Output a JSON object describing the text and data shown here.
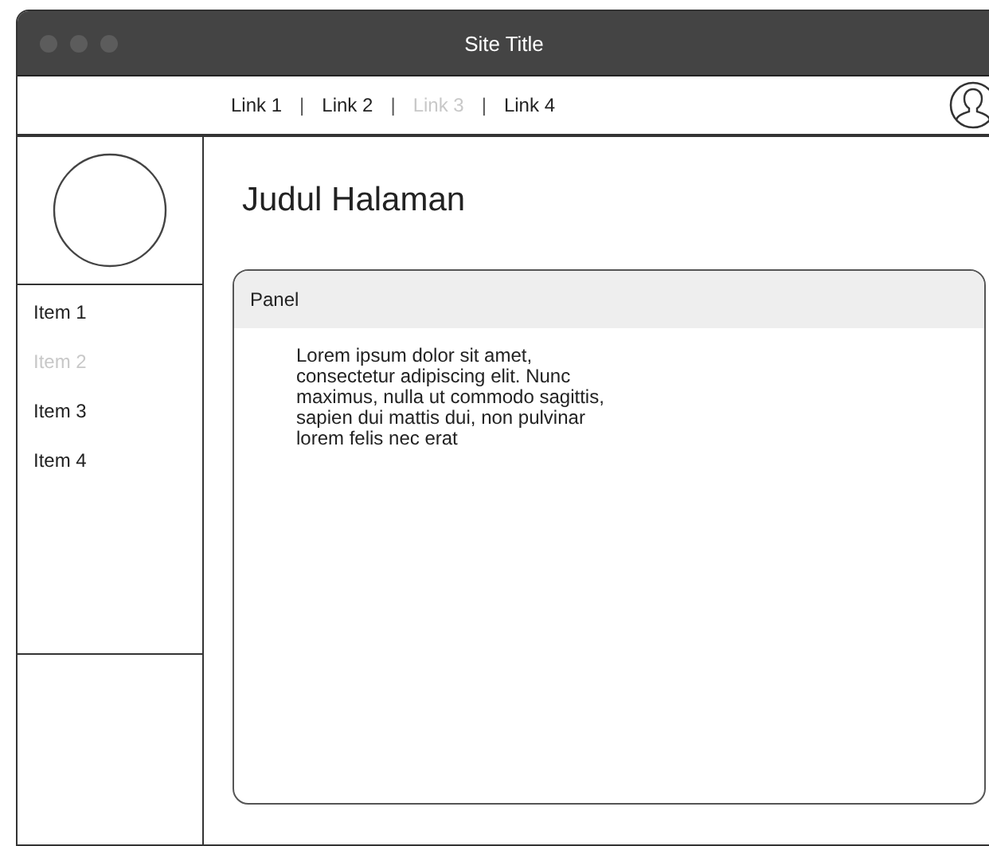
{
  "window": {
    "title": "Site Title"
  },
  "nav": {
    "links": [
      {
        "label": "Link 1",
        "disabled": false
      },
      {
        "label": "Link 2",
        "disabled": false
      },
      {
        "label": "Link 3",
        "disabled": true
      },
      {
        "label": "Link 4",
        "disabled": false
      }
    ],
    "separator": "|"
  },
  "sidebar": {
    "items": [
      {
        "label": "Item 1",
        "disabled": false
      },
      {
        "label": "Item 2",
        "disabled": true
      },
      {
        "label": "Item 3",
        "disabled": false
      },
      {
        "label": "Item 4",
        "disabled": false
      }
    ]
  },
  "page": {
    "heading": "Judul Halaman"
  },
  "panel": {
    "title": "Panel",
    "body": "Lorem ipsum dolor sit amet,\nconsectetur adipiscing elit. Nunc\nmaximus, nulla ut commodo sagittis,\nsapien dui mattis dui, non pulvinar\nlorem felis nec erat"
  }
}
